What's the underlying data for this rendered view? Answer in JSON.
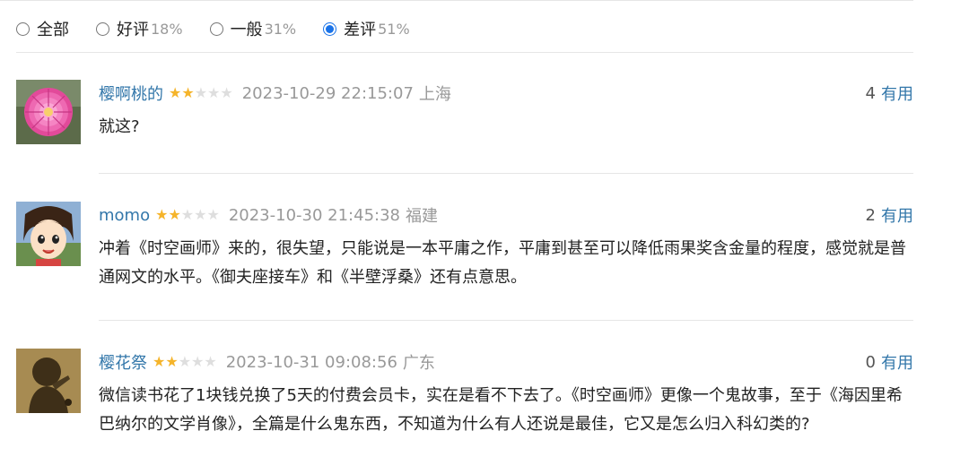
{
  "filters": [
    {
      "label": "全部",
      "pct": "",
      "checked": false
    },
    {
      "label": "好评",
      "pct": "18%",
      "checked": false
    },
    {
      "label": "一般",
      "pct": "31%",
      "checked": false
    },
    {
      "label": "差评",
      "pct": "51%",
      "checked": true
    }
  ],
  "reviews": [
    {
      "user": "樱啊桃的",
      "rating": 2,
      "time": "2023-10-29 22:15:07",
      "location": "上海",
      "useful_count": "4",
      "useful_label": "有用",
      "content": "就这?"
    },
    {
      "user": "momo",
      "rating": 2,
      "time": "2023-10-30 21:45:38",
      "location": "福建",
      "useful_count": "2",
      "useful_label": "有用",
      "content": "冲着《时空画师》来的，很失望，只能说是一本平庸之作，平庸到甚至可以降低雨果奖含金量的程度，感觉就是普通网文的水平。《御夫座接车》和《半壁浮桑》还有点意思。"
    },
    {
      "user": "樱花祭",
      "rating": 2,
      "time": "2023-10-31 09:08:56",
      "location": "广东",
      "useful_count": "0",
      "useful_label": "有用",
      "content": "微信读书花了1块钱兑换了5天的付费会员卡，实在是看不下去了。《时空画师》更像一个鬼故事，至于《海因里希巴纳尔的文学肖像》，全篇是什么鬼东西，不知道为什么有人还说是最佳，它又是怎么归入科幻类的?"
    }
  ],
  "colors": {
    "accent": "#3377aa",
    "star": "#f5b42a",
    "radio": "#1a73e8"
  }
}
